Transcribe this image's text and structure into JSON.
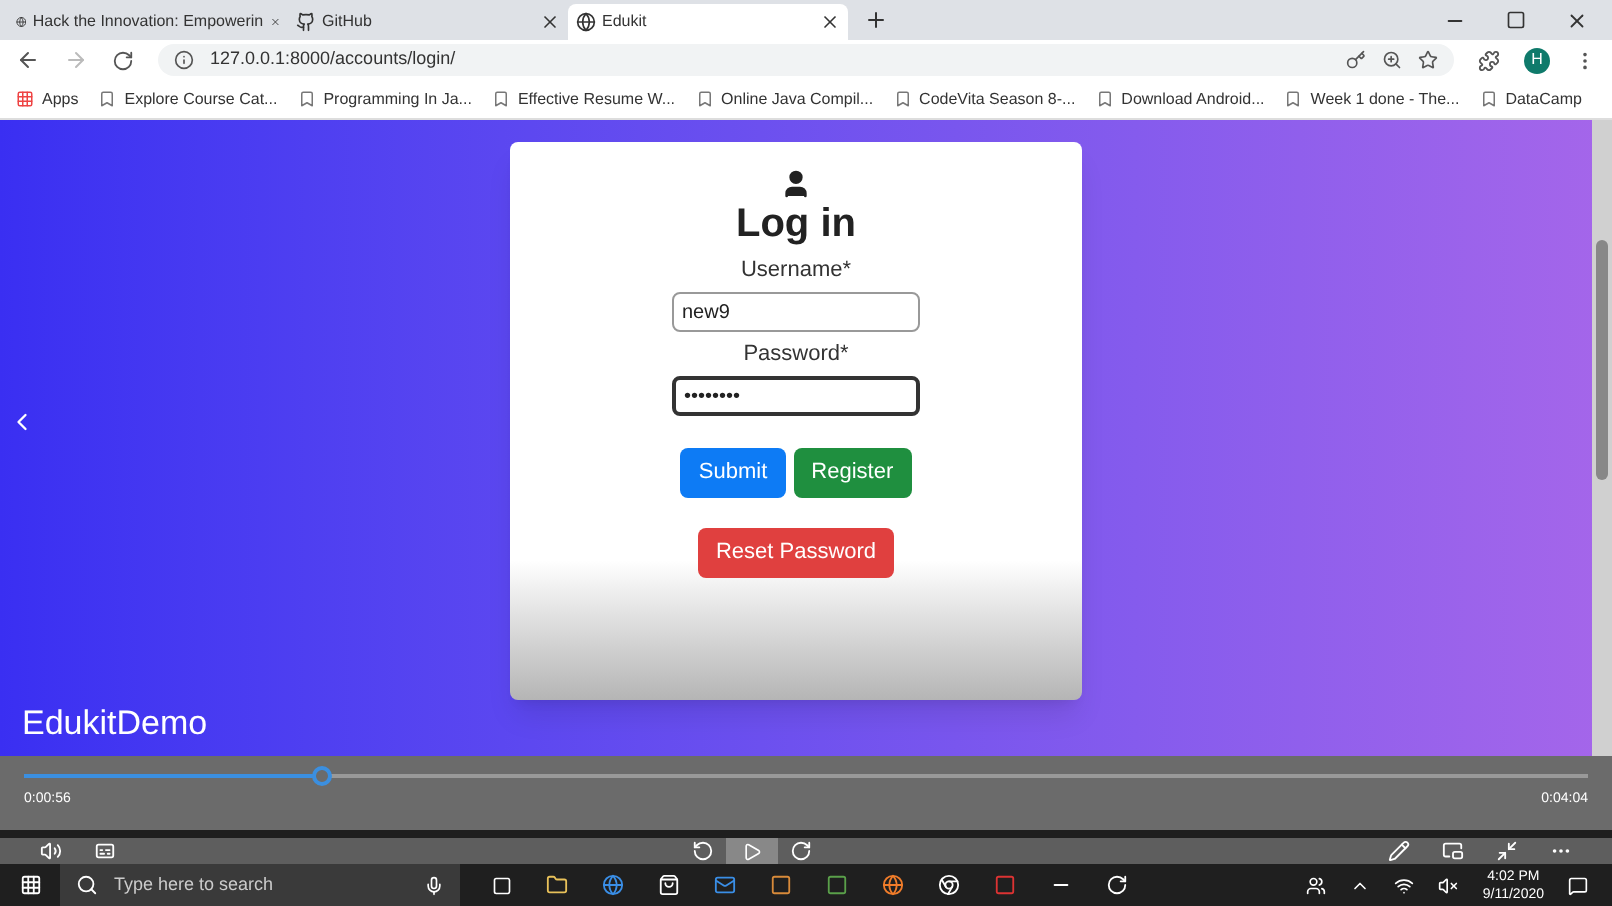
{
  "tabs": [
    {
      "title": "Hack the Innovation: Empowerin",
      "selected": false
    },
    {
      "title": "GitHub",
      "selected": false
    },
    {
      "title": "Edukit",
      "selected": true
    }
  ],
  "address": "127.0.0.1:8000/accounts/login/",
  "bookmarks": [
    "Apps",
    "Explore Course Cat...",
    "Programming In Ja...",
    "Effective Resume W...",
    "Online Java Compil...",
    "CodeVita Season 8-...",
    "Download Android...",
    "Week 1 done - The...",
    "DataCamp"
  ],
  "profile_initial": "H",
  "login": {
    "title": "Log in",
    "fields": [
      {
        "label": "Username*",
        "value": "new9",
        "focused": false
      },
      {
        "label": "Password*",
        "value": "••••••••",
        "focused": true
      }
    ],
    "buttons": [
      {
        "label": "Submit",
        "kind": "primary"
      },
      {
        "label": "Register",
        "kind": "success"
      }
    ],
    "reset_button": {
      "label": "Reset Password",
      "kind": "danger"
    }
  },
  "video": {
    "title": "EdukitDemo",
    "level": 0.19,
    "elapsed": "0:00:56",
    "total": "0:04:04"
  },
  "taskbar": {
    "search_placeholder": "Type here to search",
    "time": "4:02 PM",
    "date": "9/11/2020"
  }
}
